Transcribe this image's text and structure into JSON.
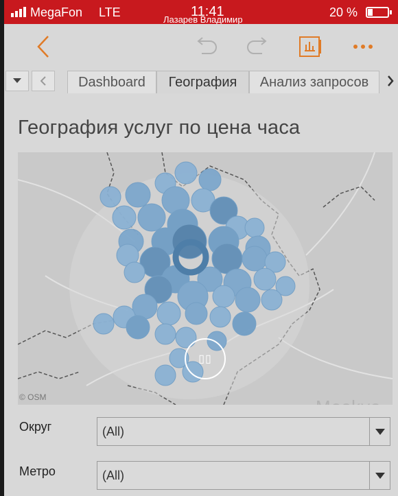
{
  "status_bar": {
    "carrier": "MegaFon",
    "network": "LTE",
    "time": "11:41",
    "user": "Лазарев Владимир",
    "battery": "20 %"
  },
  "toolbar": {
    "back_icon": "chevron-left-icon",
    "undo_icon": "undo-icon",
    "redo_icon": "redo-icon",
    "data_icon": "chart-data-icon",
    "more_icon": "more-dots-icon",
    "accent_color": "#e07b27"
  },
  "tabs": [
    {
      "label": "Dashboard",
      "active": false
    },
    {
      "label": "География",
      "active": true
    },
    {
      "label": "Анализ запросов",
      "active": false
    }
  ],
  "page": {
    "title": "География услуг по цена часа"
  },
  "map": {
    "attribution": "© OSM",
    "city_label": "Moskva",
    "point_color": "#7ba6cc",
    "point_color_dark": "#4e7ea8"
  },
  "filters": [
    {
      "label": "Округ",
      "value": "(All)"
    },
    {
      "label": "Метро",
      "value": "(All)"
    }
  ]
}
